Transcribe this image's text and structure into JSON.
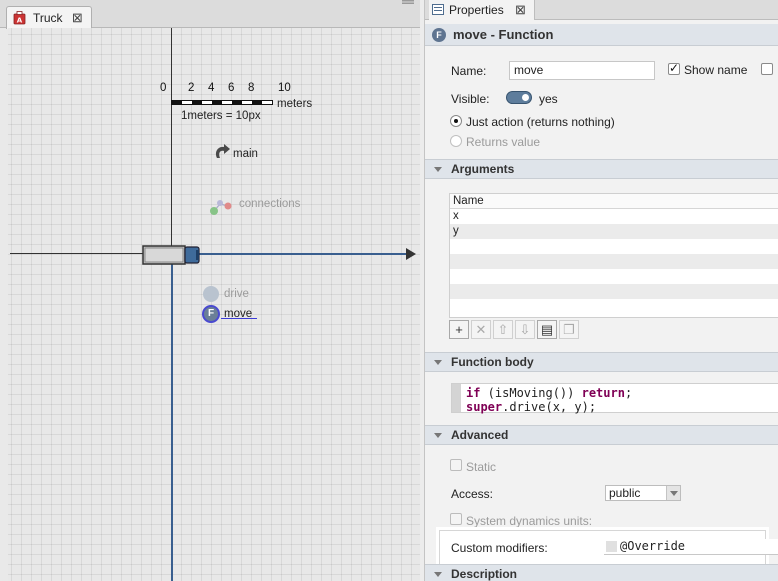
{
  "editor": {
    "tab_label": "Truck",
    "close_glyph": "⊠",
    "scale": {
      "ticks": [
        "0",
        "2",
        "4",
        "6",
        "8",
        "10"
      ],
      "unit": "meters",
      "caption": "1meters = 10px"
    },
    "objects": {
      "main": "main",
      "connections": "connections",
      "drive": "drive",
      "move": "move",
      "move_badge": "F"
    }
  },
  "properties": {
    "tab_label": "Properties",
    "close_glyph": "⊠",
    "title": "move - Function",
    "title_badge": "F",
    "name_label": "Name:",
    "name_value": "move",
    "show_name_label": "Show name",
    "show_name_checked": true,
    "visible_label": "Visible:",
    "visible_value": "yes",
    "just_action_label": "Just action (returns nothing)",
    "returns_value_label": "Returns value",
    "sections": {
      "arguments": "Arguments",
      "function_body": "Function body",
      "advanced": "Advanced",
      "description": "Description"
    },
    "arguments_table": {
      "header": "Name",
      "rows": [
        "x",
        "y"
      ]
    },
    "arg_toolbar": [
      "+",
      "✕",
      "⇧",
      "⇩",
      "▤",
      "❐"
    ],
    "code": {
      "line1_kw1": "if",
      "line1_mid": " (isMoving()) ",
      "line1_kw2": "return",
      "line1_end": ";",
      "line2_kw": "super",
      "line2_rest": ".drive(x, y);"
    },
    "static_label": "Static",
    "access_label": "Access:",
    "access_value": "public",
    "sysdyn_label": "System dynamics units:",
    "custom_modifiers_label": "Custom modifiers:",
    "custom_modifiers_value": "@Override"
  },
  "colors": {
    "axis_blue": "#3a5f8f",
    "keyword": "#7f0055",
    "section_bg": "#dfe4ea"
  }
}
